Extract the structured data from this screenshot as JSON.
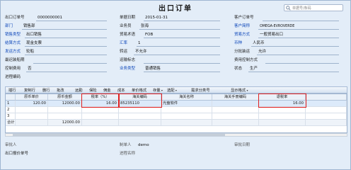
{
  "title": "出口订单",
  "search": {
    "placeholder": "单据号/条码"
  },
  "header_fields": {
    "order_no_label": "出口订单号",
    "order_no": "0000000001",
    "doc_date_label": "单据日期",
    "doc_date": "2015-01-31",
    "customer_order_label": "客户订单号",
    "customer_order": "",
    "dept_label": "部门",
    "dept": "销售部",
    "salesman_label": "业务员",
    "salesman": "张海",
    "customer_label": "客户简称",
    "customer": "OMEGA-EVROVERDE",
    "sales_type_label": "销售类型",
    "sales_type": "出口销售",
    "trade_terms_label": "贸易术语",
    "trade_terms": "FOB",
    "trade_mode_label": "贸易方式",
    "trade_mode": "一般贸易出口",
    "settle_label": "结算方式",
    "settle": "现金支票",
    "rate_label": "汇率",
    "rate": "1",
    "currency_label": "币种",
    "currency": "人民币",
    "ship_label": "发运方式",
    "ship": "轮船",
    "transship_label": "转运",
    "transship": "不允许",
    "partial_label": "分批装运",
    "partial": "允许",
    "latest_ship_label": "最迟装船期",
    "latest_ship": "",
    "shipping_mark_label": "运输标志",
    "shipping_mark": "",
    "fee_control_label": "费用控制方式",
    "fee_control": "",
    "control_usage_label": "控制费用",
    "control_usage": "否",
    "biz_type_label": "业务类型",
    "biz_type": "普通销售",
    "status_label": "状态",
    "status": "生产",
    "memo_label": "进程编码",
    "memo": ""
  },
  "toolbar": [
    "插行",
    "复制行",
    "删行",
    "批改",
    "远勤",
    "保险",
    "佣金",
    "成本",
    "单价格式",
    "存量",
    "选配",
    "需求分类号",
    "显示格式"
  ],
  "toolbar_dropdowns": [
    false,
    false,
    false,
    false,
    false,
    false,
    false,
    false,
    false,
    true,
    true,
    false,
    true
  ],
  "grid": {
    "columns": [
      "原币单价",
      "原币金额",
      "税率（%）",
      "海关编码",
      "海关名称",
      "海关手册编码",
      "退税率"
    ],
    "rows": [
      {
        "no": "1",
        "unit_price": "120.00",
        "amount": "12000.00",
        "tax_rate": "16.00",
        "customs_code": "85235110",
        "customs_name": "光盘软件",
        "manual_code": "",
        "refund_rate": "16.00"
      },
      {
        "no": "2",
        "unit_price": "",
        "amount": "",
        "tax_rate": "",
        "customs_code": "",
        "customs_name": "",
        "manual_code": "",
        "refund_rate": ""
      },
      {
        "no": "3",
        "unit_price": "",
        "amount": "",
        "tax_rate": "",
        "customs_code": "",
        "customs_name": "",
        "manual_code": "",
        "refund_rate": ""
      }
    ],
    "total_label": "合计",
    "total_amount": "12000.00"
  },
  "footer": {
    "auditor_label": "审批人",
    "auditor": "",
    "maker_label": "制单人",
    "maker": "demo",
    "audit_date_label": "审批日期",
    "audit_date": "",
    "quote_no_label": "出口报价单号",
    "quote_no": "",
    "process_name_label": "进程名称",
    "process_name": ""
  },
  "colors": {
    "highlight_border": "#e02020",
    "label_blue": "#0a44b8",
    "background": "#e3edf8"
  }
}
